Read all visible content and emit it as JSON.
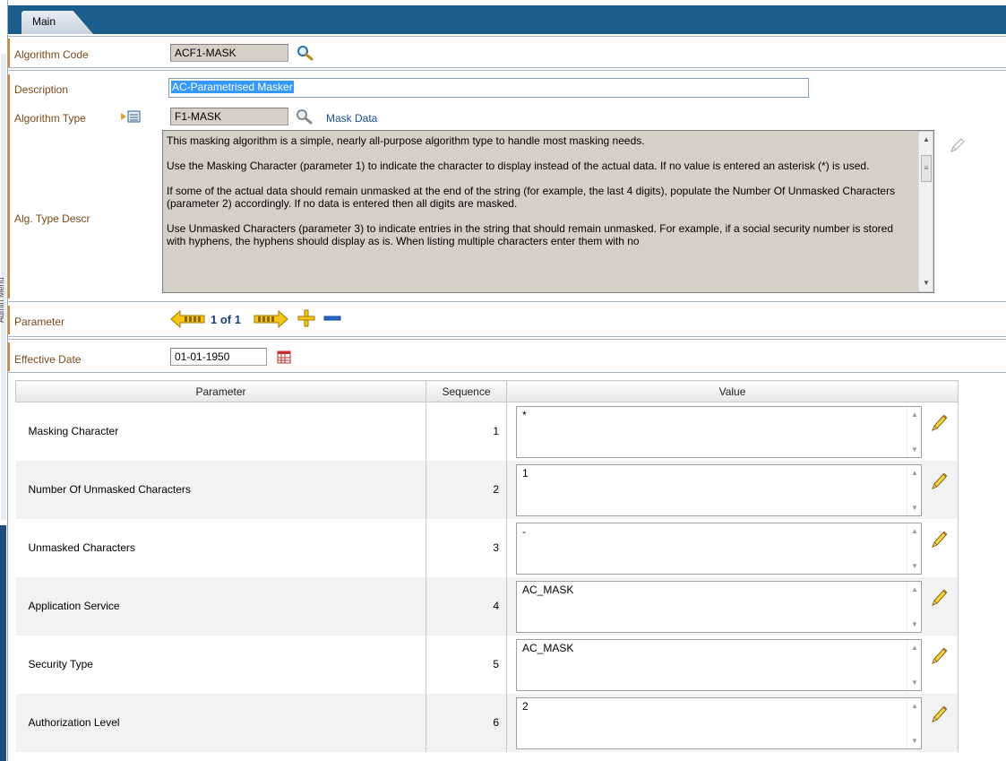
{
  "sidebar": {
    "label": "Admin Menu"
  },
  "tabs": [
    {
      "label": "Main"
    }
  ],
  "algorithm_code": {
    "label": "Algorithm Code",
    "value": "ACF1-MASK",
    "search_icon": "search-icon"
  },
  "description": {
    "label": "Description",
    "value": "AC-Parametrised Masker"
  },
  "algorithm_type": {
    "label": "Algorithm Type",
    "value": "F1-MASK",
    "link": "Mask Data"
  },
  "alg_type_descr": {
    "label": "Alg. Type Descr",
    "paragraphs": [
      "This masking algorithm is a simple, nearly all-purpose algorithm type to handle most masking needs.",
      "Use the Masking Character (parameter 1) to indicate the character to display instead of the actual data.  If no value is entered an asterisk (*) is used.",
      "If some of the actual data should remain unmasked at the end of the string (for example, the last 4 digits), populate the Number Of Unmasked Characters (parameter 2) accordingly.  If no data is entered then all digits are masked.",
      "Use Unmasked Characters (parameter 3) to indicate entries in the string that should remain unmasked.  For example, if a social security number is stored with hyphens, the hyphens should display as is.  When listing multiple characters enter them with no"
    ]
  },
  "parameter_nav": {
    "label": "Parameter",
    "counter": "1 of 1"
  },
  "effective_date": {
    "label": "Effective Date",
    "value": "01-01-1950"
  },
  "table": {
    "headers": [
      "Parameter",
      "Sequence",
      "Value"
    ],
    "rows": [
      {
        "name": "Masking Character",
        "sequence": "1",
        "value": "*"
      },
      {
        "name": "Number Of Unmasked Characters",
        "sequence": "2",
        "value": "1"
      },
      {
        "name": "Unmasked Characters",
        "sequence": "3",
        "value": "-"
      },
      {
        "name": "Application Service",
        "sequence": "4",
        "value": "AC_MASK"
      },
      {
        "name": "Security Type",
        "sequence": "5",
        "value": "AC_MASK"
      },
      {
        "name": "Authorization Level",
        "sequence": "6",
        "value": "2"
      }
    ]
  },
  "colors": {
    "tab_bar": "#1b5e8c",
    "label_text": "#7a4a1a",
    "link": "#1b4f9c",
    "nav_arrow": "#f5c518"
  }
}
